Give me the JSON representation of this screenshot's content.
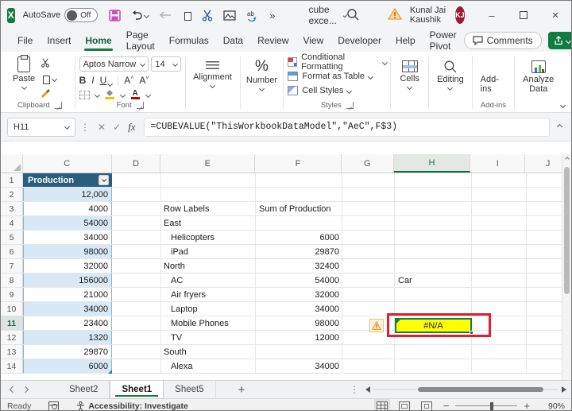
{
  "titlebar": {
    "autosave_label": "AutoSave",
    "autosave_state": "Off",
    "doc_title": "cube exce...",
    "user_name": "Kunal Jai Kaushik",
    "user_initials": "KJ"
  },
  "menubar": {
    "tabs": [
      "File",
      "Insert",
      "Home",
      "Page Layout",
      "Formulas",
      "Data",
      "Review",
      "View",
      "Developer",
      "Help",
      "Power Pivot"
    ],
    "active_tab": "Home",
    "comments_label": "Comments"
  },
  "ribbon": {
    "paste_label": "Paste",
    "clipboard_group": "Clipboard",
    "font_name": "Aptos Narrow",
    "font_size": "14",
    "bold": "B",
    "italic": "I",
    "underline": "U",
    "font_group": "Font",
    "alignment_label": "Alignment",
    "number_label": "Number",
    "styles": [
      "Conditional Formatting",
      "Format as Table",
      "Cell Styles"
    ],
    "styles_group": "Styles",
    "cells_label": "Cells",
    "editing_label": "Editing",
    "addins_label": "Add-ins",
    "analyze_label": "Analyze Data",
    "addins_group": "Add-ins"
  },
  "formula_bar": {
    "name_box": "H11",
    "fx_label": "fx",
    "formula": "=CUBEVALUE(\"ThisWorkbookDataModel\",\"AeC\",F$3)"
  },
  "grid": {
    "columns": [
      "C",
      "D",
      "E",
      "F",
      "G",
      "H",
      "I",
      "J"
    ],
    "selected_cell": "H11",
    "rows": [
      {
        "n": "1",
        "c": "Production"
      },
      {
        "n": "2",
        "c": "12,000"
      },
      {
        "n": "3",
        "c": "4000",
        "e": "Row Labels",
        "f": "Sum of Production"
      },
      {
        "n": "4",
        "c": "54000",
        "e": "East"
      },
      {
        "n": "5",
        "c": "34000",
        "e": "Helicopters",
        "f": "6000"
      },
      {
        "n": "6",
        "c": "98000",
        "e": "iPad",
        "f": "29870"
      },
      {
        "n": "7",
        "c": "32000",
        "e": "North",
        "f": "32400"
      },
      {
        "n": "8",
        "c": "156000",
        "e": "AC",
        "f": "54000",
        "h": "Car"
      },
      {
        "n": "9",
        "c": "21000",
        "e": "Air fryers",
        "f": "32000"
      },
      {
        "n": "10",
        "c": "34000",
        "e": "Laptop",
        "f": "34000"
      },
      {
        "n": "11",
        "c": "23400",
        "e": "Mobile Phones",
        "f": "98000",
        "h": "#N/A"
      },
      {
        "n": "12",
        "c": "1320",
        "e": "TV",
        "f": "12000"
      },
      {
        "n": "13",
        "c": "29870",
        "e": "South"
      },
      {
        "n": "14",
        "c": "6000",
        "e": "Alexa",
        "f": "34000"
      }
    ]
  },
  "sheet_tabs": {
    "tabs": [
      "Sheet2",
      "Sheet1",
      "Sheet5"
    ],
    "active": "Sheet1",
    "add_label": "+"
  },
  "status_bar": {
    "mode": "Ready",
    "accessibility": "Accessibility: Investigate",
    "zoom": "90%"
  },
  "colors": {
    "accent_green": "#107C41",
    "table_header_blue": "#2B5D7D",
    "banded_row_blue": "#D8E9F5",
    "error_cell_fill": "#FFFF00",
    "annotation_red": "#E11D2E",
    "avatar_maroon": "#9B1B33",
    "warning_orange": "#E8A33D",
    "save_icon_magenta": "#C94FBE"
  }
}
